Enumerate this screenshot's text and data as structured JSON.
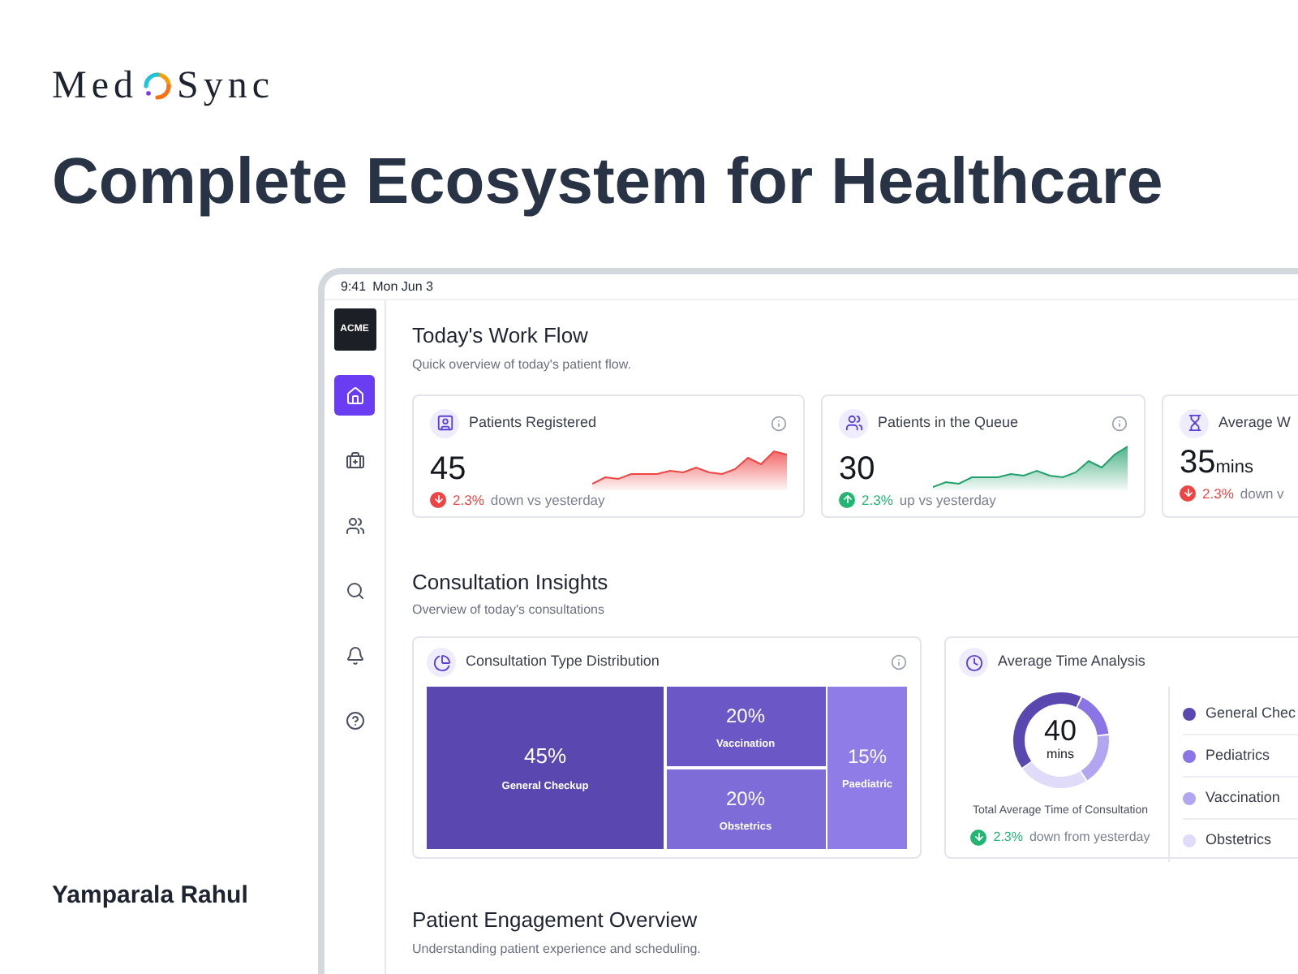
{
  "brand": {
    "name_left": "Med",
    "name_right": "Sync"
  },
  "headline": "Complete Ecosystem for Healthcare",
  "author": "Yamparala Rahul",
  "status_bar": {
    "time": "9:41",
    "date": "Mon Jun 3"
  },
  "sidebar": {
    "logo": "ACME",
    "items": [
      {
        "kind": "home",
        "selected": true
      },
      {
        "kind": "medical-kit",
        "selected": false
      },
      {
        "kind": "people",
        "selected": false
      },
      {
        "kind": "search",
        "selected": false
      },
      {
        "kind": "bell",
        "selected": false
      },
      {
        "kind": "help",
        "selected": false
      }
    ]
  },
  "work_flow": {
    "title": "Today's Work Flow",
    "subtitle": "Quick overview of today's patient flow.",
    "metrics": [
      {
        "kind": "registered",
        "title": "Patients Registered",
        "value": "45",
        "change": "2.3%",
        "change_text": "down vs yesterday",
        "rising": false,
        "positive": false,
        "info": true
      },
      {
        "kind": "queue",
        "title": "Patients in the Queue",
        "value": "30",
        "change": "2.3%",
        "change_text": "up vs yesterday",
        "rising": true,
        "positive": true,
        "info": true
      },
      {
        "kind": "wait",
        "title": "Average W",
        "value": "35",
        "unit": "mins",
        "change": "2.3%",
        "change_text": "down v",
        "rising": false,
        "positive": false,
        "info": false
      }
    ]
  },
  "insights": {
    "title": "Consultation Insights",
    "subtitle": "Overview of today's consultations",
    "distribution": {
      "title": "Consultation Type Distribution",
      "items": [
        {
          "value": "45%",
          "label": "General Checkup",
          "color": "#5a48b0"
        },
        {
          "value": "20%",
          "label": "Vaccination",
          "color": "#6b57c6"
        },
        {
          "value": "20%",
          "label": "Obstetrics",
          "color": "#7e6cd9"
        },
        {
          "value": "15%",
          "label": "Paediatric",
          "color": "#8f7ce6"
        }
      ]
    },
    "time": {
      "title": "Average Time Analysis",
      "value": "40",
      "unit": "mins",
      "caption": "Total Average Time of Consultation",
      "change": "2.3%",
      "change_text": "down from yesterday",
      "rising": false,
      "positive": true,
      "legend": [
        {
          "label": "General Chec",
          "color": "#5a48b0"
        },
        {
          "label": "Pediatrics",
          "color": "#8b74e6"
        },
        {
          "label": "Vaccination",
          "color": "#b4a5f0"
        },
        {
          "label": "Obstetrics",
          "color": "#e0dbf8"
        }
      ]
    }
  },
  "engagement": {
    "title": "Patient Engagement Overview",
    "subtitle": "Understanding patient experience and scheduling."
  }
}
